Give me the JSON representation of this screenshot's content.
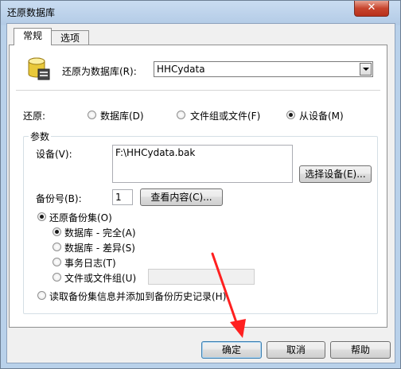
{
  "window": {
    "title": "还原数据库",
    "close_glyph": "✕"
  },
  "tabs": [
    {
      "label": "常规"
    },
    {
      "label": "选项"
    }
  ],
  "restore_to": {
    "label": "还原为数据库(R):",
    "value": "HHCydata"
  },
  "restore_source": {
    "label": "还原:",
    "options": [
      {
        "label": "数据库(D)",
        "checked": false
      },
      {
        "label": "文件组或文件(F)",
        "checked": false
      },
      {
        "label": "从设备(M)",
        "checked": true
      }
    ]
  },
  "params": {
    "title": "参数",
    "device_label": "设备(V):",
    "device_value": "F:\\HHCydata.bak",
    "select_device_button": "选择设备(E)...",
    "backup_no_label": "备份号(B):",
    "backup_no_value": "1",
    "view_contents_button": "查看内容(C)...",
    "restore_backup_set": {
      "label": "还原备份集(O)",
      "checked": true
    },
    "sub_options": [
      {
        "label": "数据库 - 完全(A)",
        "checked": true
      },
      {
        "label": "数据库 - 差异(S)",
        "checked": false
      },
      {
        "label": "事务日志(T)",
        "checked": false
      },
      {
        "label": "文件或文件组(U)",
        "checked": false
      }
    ],
    "read_backup_info": {
      "label": "读取备份集信息并添加到备份历史记录(H)",
      "checked": false
    }
  },
  "footer": {
    "ok": "确定",
    "cancel": "取消",
    "help": "帮助"
  },
  "colors": {
    "annotation_arrow": "#ff2020",
    "frame": "#b9d1ea"
  }
}
